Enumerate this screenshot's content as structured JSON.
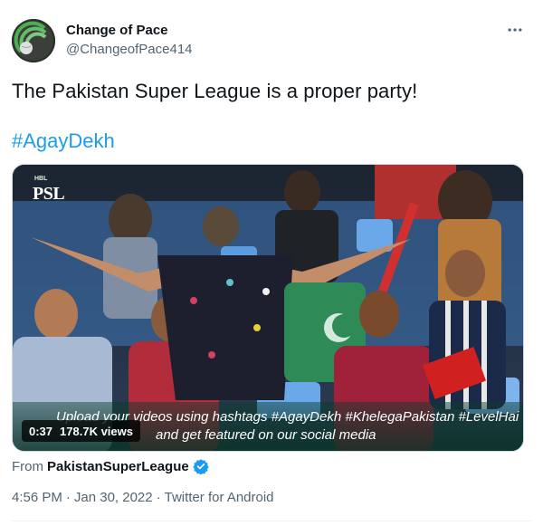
{
  "author": {
    "display_name": "Change of Pace",
    "handle": "@ChangeofPace414",
    "avatar_icon": "cricket-ball-signal-icon"
  },
  "tweet": {
    "text": "The Pakistan Super League is a proper party!",
    "hashtag": "#AgayDekh"
  },
  "video": {
    "logo_small": "HBL",
    "logo_main": "PSL",
    "caption_line1": "Upload your videos using hashtags #AgayDekh #KhelegaPakistan #LevelHai",
    "caption_line2": "and get featured on our social media",
    "duration": "0:37",
    "views": "178.7K views"
  },
  "source": {
    "prefix": "From",
    "name": "PakistanSuperLeague",
    "verified": true
  },
  "meta": {
    "time": "4:56 PM",
    "separator1": "·",
    "date": "Jan 30, 2022",
    "separator2": "·",
    "client": "Twitter for Android"
  },
  "colors": {
    "link": "#1d9bf0",
    "secondary_text": "#536471",
    "verified": "#1d9bf0"
  }
}
